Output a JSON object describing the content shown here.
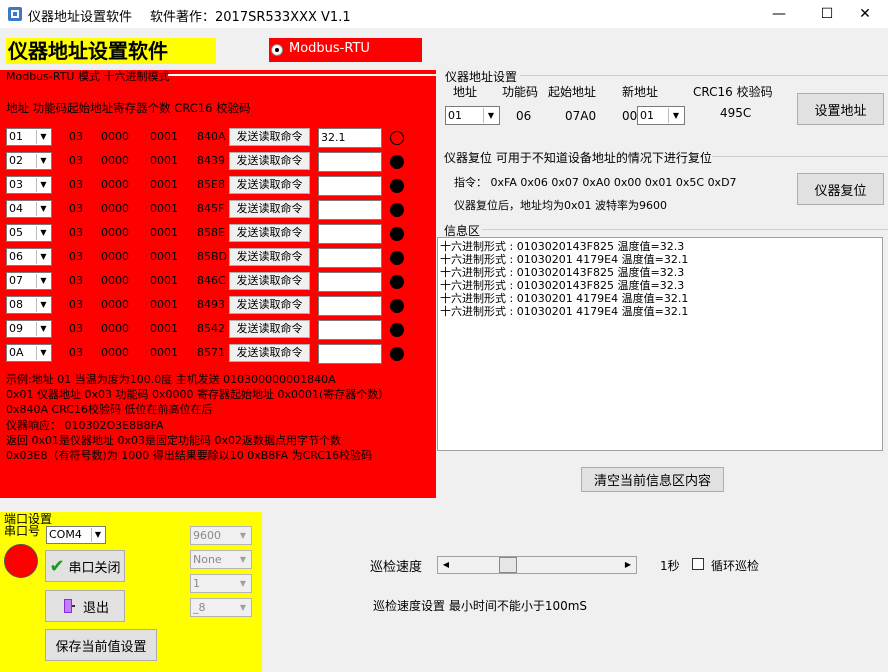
{
  "window": {
    "title": "仪器地址设置软件",
    "author_version": "软件著作：2017SR533XXX V1.1",
    "minimize": "—",
    "maximize": "☐",
    "close": "✕"
  },
  "header": {
    "big_title": "仪器地址设置软件",
    "mode_radio_label": "Modbus-RTU",
    "mode_radio_selected": true
  },
  "red_panel": {
    "legend": "Modbus-RTU 模式 十六进制模式",
    "column_header": "地址  功能码起始地址寄存器个数 CRC16 校验码",
    "rows": [
      {
        "addr": "01",
        "func": "03",
        "start": "0000",
        "count": "0001",
        "crc": "840A",
        "button": "发送读取命令",
        "value": "32.1",
        "led": "off"
      },
      {
        "addr": "02",
        "func": "03",
        "start": "0000",
        "count": "0001",
        "crc": "8439",
        "button": "发送读取命令",
        "value": "",
        "led": "on"
      },
      {
        "addr": "03",
        "func": "03",
        "start": "0000",
        "count": "0001",
        "crc": "85E8",
        "button": "发送读取命令",
        "value": "",
        "led": "on"
      },
      {
        "addr": "04",
        "func": "03",
        "start": "0000",
        "count": "0001",
        "crc": "845F",
        "button": "发送读取命令",
        "value": "",
        "led": "on"
      },
      {
        "addr": "05",
        "func": "03",
        "start": "0000",
        "count": "0001",
        "crc": "858E",
        "button": "发送读取命令",
        "value": "",
        "led": "on"
      },
      {
        "addr": "06",
        "func": "03",
        "start": "0000",
        "count": "0001",
        "crc": "85BD",
        "button": "发送读取命令",
        "value": "",
        "led": "on"
      },
      {
        "addr": "07",
        "func": "03",
        "start": "0000",
        "count": "0001",
        "crc": "846C",
        "button": "发送读取命令",
        "value": "",
        "led": "on"
      },
      {
        "addr": "08",
        "func": "03",
        "start": "0000",
        "count": "0001",
        "crc": "8493",
        "button": "发送读取命令",
        "value": "",
        "led": "on"
      },
      {
        "addr": "09",
        "func": "03",
        "start": "0000",
        "count": "0001",
        "crc": "8542",
        "button": "发送读取命令",
        "value": "",
        "led": "on"
      },
      {
        "addr": "0A",
        "func": "03",
        "start": "0000",
        "count": "0001",
        "crc": "8571",
        "button": "发送读取命令",
        "value": "",
        "led": "on"
      }
    ],
    "notes": [
      "示例:地址 01 当温为度为100.0度   主机发送 010300000001840A",
      "0x01 仪器地址 0x03 功能码 0x0000 寄存器起始地址  0x0001(寄存器个数）",
      "0x840A CRC16校验码 低位在前高位在后",
      "  仪器响应：  010302O3E8B8FA",
      "返回 0x01是仪器地址 0x03是固定功能码 0x02返数据点用字节个数",
      "0x03E8（有符号数)为 1000 得出结果要除以10 0xB8FA 为CRC16校验码"
    ]
  },
  "address_settings": {
    "group_label": "仪器地址设置",
    "col_addr": "地址",
    "col_func": "功能码",
    "col_start": "起始地址",
    "col_new": "新地址",
    "col_crc": "CRC16 校验码",
    "addr_value": "01",
    "func_value": "06",
    "start_value": "07A0",
    "new_prefix": "00",
    "new_value": "01",
    "crc_value": "495C",
    "set_button": "设置地址"
  },
  "reset": {
    "group_label": "仪器复位 可用于不知道设备地址的情况下进行复位",
    "command": "指令： 0xFA 0x06 0x07 0xA0 0x00 0x01 0x5C 0xD7",
    "note": "仪器复位后，地址均为0x01 波特率为9600",
    "button": "仪器复位"
  },
  "info": {
    "label": "信息区",
    "lines": [
      "十六进制形式 : 0103020143F825  温度值=32.3",
      "十六进制形式 : 01030201 4179E4  温度值=32.1",
      "十六进制形式 : 0103020143F825  温度值=32.3",
      "十六进制形式 : 0103020143F825  温度值=32.3",
      "十六进制形式 : 01030201 4179E4  温度值=32.1",
      "十六进制形式 : 01030201 4179E4  温度值=32.1"
    ],
    "clear_button": "清空当前信息区内容"
  },
  "serial": {
    "legend": "端口设置",
    "port_label": "串口号",
    "port_value": "COM4",
    "close_button": "串口关闭",
    "exit_button": "退出",
    "save_button": "保存当前值设置",
    "baud": "9600",
    "parity": "None",
    "stop_bits": "1",
    "data_bits": "_8",
    "status": "closed"
  },
  "patrol": {
    "speed_label": "巡检速度",
    "speed_value": "1秒",
    "loop_label": "循环巡检",
    "loop_checked": false,
    "note": "巡检速度设置 最小时间不能小于100mS",
    "slider_fraction": 0.33
  },
  "colors": {
    "red_panel": "#ff0000",
    "yellow": "#ffff00",
    "led_on": "#000000",
    "led_off": "#ff0000"
  }
}
